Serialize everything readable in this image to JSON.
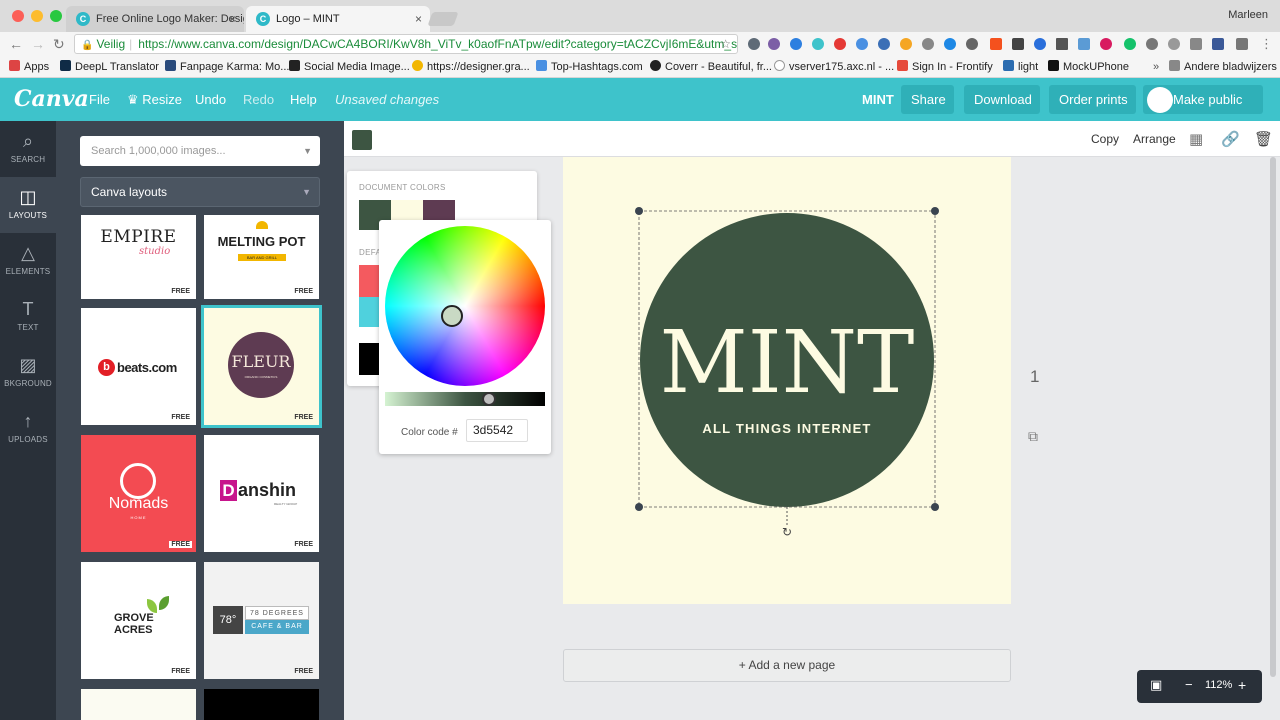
{
  "browser": {
    "tabs": [
      {
        "title": "Free Online Logo Maker: Desig",
        "favicon": "C"
      },
      {
        "title": "Logo – MINT",
        "favicon": "C"
      }
    ],
    "user": "Marleen",
    "secure_label": "Veilig",
    "url": "https://www.canva.com/design/DACwCA4BORI/KwV8h_ViTv_k0aofFnATpw/edit?category=tACZCvjI6mE&utm_s...",
    "bookmarks": [
      "Apps",
      "DeepL Translator",
      "Fanpage Karma: Mo...",
      "Social Media Image...",
      "https://designer.gra...",
      "Top-Hashtags.com",
      "Coverr - Beautiful, fr...",
      "vserver175.axc.nl - ...",
      "Sign In - Frontify",
      "light",
      "MockUPhone"
    ],
    "more_bookmarks": "»",
    "other_bookmarks": "Andere bladwijzers"
  },
  "header": {
    "logo": "Canva",
    "menu": {
      "file": "File",
      "resize": "Resize",
      "undo": "Undo",
      "redo": "Redo",
      "help": "Help"
    },
    "unsaved": "Unsaved changes",
    "design_name": "MINT",
    "share": "Share",
    "download": "Download",
    "order_prints": "Order prints",
    "make_public": "Make public"
  },
  "sidebar": {
    "items": [
      {
        "label": "SEARCH",
        "icon": "search-icon"
      },
      {
        "label": "LAYOUTS",
        "icon": "layouts-icon"
      },
      {
        "label": "ELEMENTS",
        "icon": "elements-icon"
      },
      {
        "label": "TEXT",
        "icon": "text-icon"
      },
      {
        "label": "BKGROUND",
        "icon": "background-icon"
      },
      {
        "label": "UPLOADS",
        "icon": "uploads-icon"
      }
    ]
  },
  "panel": {
    "search_placeholder": "Search 1,000,000 images...",
    "dropdown": "Canva layouts",
    "free_badge": "FREE",
    "layouts": {
      "empire": "EMPIRE",
      "empire_script": "studio",
      "melting": "MELTING POT",
      "melting_sub": "BAR AND GRILL",
      "beats": "beats.com",
      "fleur": "FLEUR",
      "fleur_sub": "ORGANIC COSMETICS",
      "nomads": "Nomads",
      "nomads_sub": "HOME",
      "danshin": "anshin",
      "danshin_d": "D",
      "danshin_sub": "REALTY GROUP",
      "grove1": "GROVE",
      "grove2": "ACRES",
      "deg_num": "78°",
      "deg_top": "78 DEGREES",
      "deg_bottom": "CAFE & BAR"
    }
  },
  "toolbar": {
    "copy": "Copy",
    "arrange": "Arrange"
  },
  "color_popover": {
    "document_colors": "DOCUMENT COLORS",
    "default_colors": "DEFA",
    "doc_swatches": [
      "#3d5542",
      "#fdfbe2",
      "#5e3b52"
    ],
    "default_swatches": [
      "#f45a5f",
      "#4fd1dd",
      "#000000"
    ],
    "code_label": "Color code #",
    "code_value": "3d5542"
  },
  "design": {
    "title": "MINT",
    "tagline": "ALL THINGS INTERNET",
    "circle_color": "#3d5542",
    "page_color": "#fdfbe2"
  },
  "workspace": {
    "add_page": "+ Add a new page",
    "page_number": "1",
    "zoom": "112%",
    "zoom_minus": "−",
    "zoom_plus": "+"
  }
}
